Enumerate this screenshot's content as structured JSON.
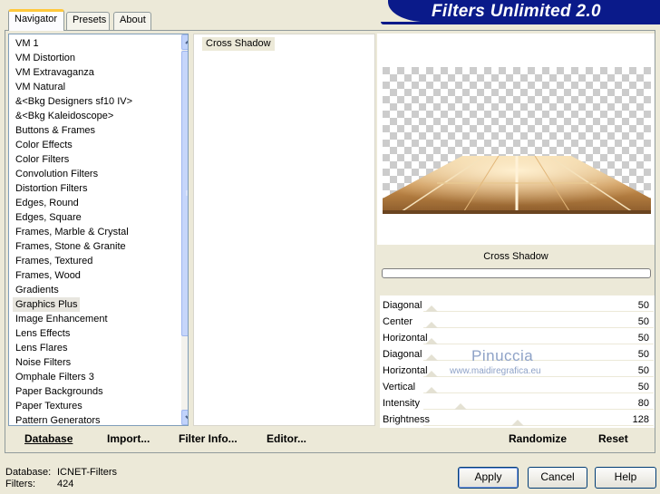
{
  "app_title": "Filters Unlimited 2.0",
  "tabs": [
    {
      "label": "Navigator",
      "active": true
    },
    {
      "label": "Presets",
      "active": false
    },
    {
      "label": "About",
      "active": false
    }
  ],
  "categories": [
    "VM 1",
    "VM Distortion",
    "VM Extravaganza",
    "VM Natural",
    "&<Bkg Designers sf10 IV>",
    "&<Bkg Kaleidoscope>",
    "Buttons & Frames",
    "Color Effects",
    "Color Filters",
    "Convolution Filters",
    "Distortion Filters",
    "Edges, Round",
    "Edges, Square",
    "Frames, Marble & Crystal",
    "Frames, Stone & Granite",
    "Frames, Textured",
    "Frames, Wood",
    "Gradients",
    "Graphics Plus",
    "Image Enhancement",
    "Lens Effects",
    "Lens Flares",
    "Noise Filters",
    "Omphale Filters 3",
    "Paper Backgrounds",
    "Paper Textures",
    "Pattern Generators"
  ],
  "selected_category": "Graphics Plus",
  "filters": [
    "Cross Shadow"
  ],
  "selected_filter": "Cross Shadow",
  "preview": {
    "filter_name": "Cross Shadow",
    "progress": 0
  },
  "params": [
    {
      "label": "Diagonal",
      "value": "50"
    },
    {
      "label": "Center",
      "value": "50"
    },
    {
      "label": "Horizontal",
      "value": "50"
    },
    {
      "label": "Diagonal",
      "value": "50"
    },
    {
      "label": "Horizontal",
      "value": "50"
    },
    {
      "label": "Vertical",
      "value": "50"
    },
    {
      "label": "Intensity",
      "value": "80"
    },
    {
      "label": "Brightness",
      "value": "128"
    }
  ],
  "watermark": {
    "line1": "Pinuccia",
    "line2": "www.maidiregrafica.eu"
  },
  "toolbar": {
    "database": "Database",
    "import": "Import...",
    "filter_info": "Filter Info...",
    "editor": "Editor...",
    "randomize": "Randomize",
    "reset": "Reset"
  },
  "status": {
    "database_label": "Database:",
    "database_value": "ICNET-Filters",
    "filters_label": "Filters:",
    "filters_value": "424"
  },
  "buttons": {
    "apply": "Apply",
    "cancel": "Cancel",
    "help": "Help"
  },
  "colors": {
    "banner": "#0a1a8a",
    "background": "#ece9d8",
    "tab_highlight": "#ffc83c"
  },
  "icons": [
    "scroll-up-arrow-icon",
    "scroll-down-arrow-icon",
    "scroll-grip-icon"
  ]
}
